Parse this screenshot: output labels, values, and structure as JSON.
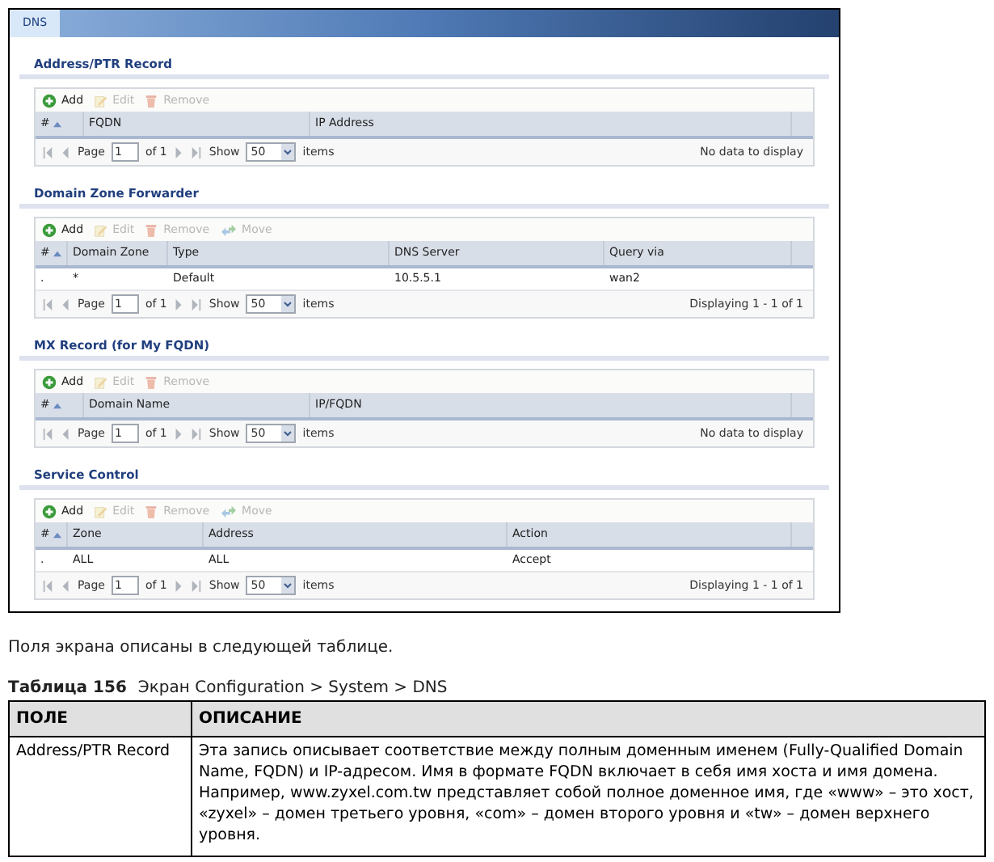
{
  "tab": {
    "label": "DNS",
    "selected": true
  },
  "sections": [
    {
      "title": "Address/PTR Record",
      "toolbar": [
        {
          "kind": "add",
          "label": "Add",
          "disabled": false
        },
        {
          "kind": "edit",
          "label": "Edit",
          "disabled": true
        },
        {
          "kind": "remove",
          "label": "Remove",
          "disabled": true
        }
      ],
      "columns": [
        "#",
        "FQDN",
        "IP Address"
      ],
      "pager": {
        "page_label": "Page",
        "page": "1",
        "of": "of 1",
        "show_label": "Show",
        "show": "50",
        "items_label": "items",
        "status": "No data to display"
      }
    },
    {
      "title": "Domain Zone Forwarder",
      "toolbar": [
        {
          "kind": "add",
          "label": "Add",
          "disabled": false
        },
        {
          "kind": "edit",
          "label": "Edit",
          "disabled": true
        },
        {
          "kind": "remove",
          "label": "Remove",
          "disabled": true
        },
        {
          "kind": "move",
          "label": "Move",
          "disabled": true
        }
      ],
      "columns": [
        "#",
        "Domain Zone",
        "Type",
        "DNS Server",
        "Query via"
      ],
      "rows": [
        [
          ".",
          "*",
          "Default",
          "10.5.5.1",
          "wan2"
        ]
      ],
      "pager": {
        "page_label": "Page",
        "page": "1",
        "of": "of 1",
        "show_label": "Show",
        "show": "50",
        "items_label": "items",
        "status": "Displaying 1 - 1 of 1"
      }
    },
    {
      "title": "MX Record (for My FQDN)",
      "toolbar": [
        {
          "kind": "add",
          "label": "Add",
          "disabled": false
        },
        {
          "kind": "edit",
          "label": "Edit",
          "disabled": true
        },
        {
          "kind": "remove",
          "label": "Remove",
          "disabled": true
        }
      ],
      "columns": [
        "#",
        "Domain Name",
        "IP/FQDN"
      ],
      "pager": {
        "page_label": "Page",
        "page": "1",
        "of": "of 1",
        "show_label": "Show",
        "show": "50",
        "items_label": "items",
        "status": "No data to display"
      }
    },
    {
      "title": "Service Control",
      "toolbar": [
        {
          "kind": "add",
          "label": "Add",
          "disabled": false
        },
        {
          "kind": "edit",
          "label": "Edit",
          "disabled": true
        },
        {
          "kind": "remove",
          "label": "Remove",
          "disabled": true
        },
        {
          "kind": "move",
          "label": "Move",
          "disabled": true
        }
      ],
      "columns": [
        "#",
        "Zone",
        "Address",
        "Action"
      ],
      "rows": [
        [
          ".",
          "ALL",
          "ALL",
          "Accept"
        ]
      ],
      "pager": {
        "page_label": "Page",
        "page": "1",
        "of": "of 1",
        "show_label": "Show",
        "show": "50",
        "items_label": "items",
        "status": "Displaying 1 - 1 of 1"
      }
    }
  ],
  "intro": "Поля экрана описаны в следующей таблице.",
  "caption": {
    "number": "Таблица 156",
    "title": "Экран Configuration > System > DNS"
  },
  "doc_table": {
    "columns": [
      "ПОЛЕ",
      "ОПИСАНИЕ"
    ],
    "rows": [
      [
        "Address/PTR Record",
        "Эта запись описывает соответствие между полным доменным именем (Fully-Qualified Domain Name, FQDN) и IP-адресом. Имя в формате FQDN включает в себя имя хоста и имя домена. Например, www.zyxel.com.tw представляет собой полное доменное имя, где «www» – это хост, «zyxel» – домен третьего уровня, «com» – домен второго уровня и «tw» – домен верхнего уровня."
      ]
    ]
  }
}
